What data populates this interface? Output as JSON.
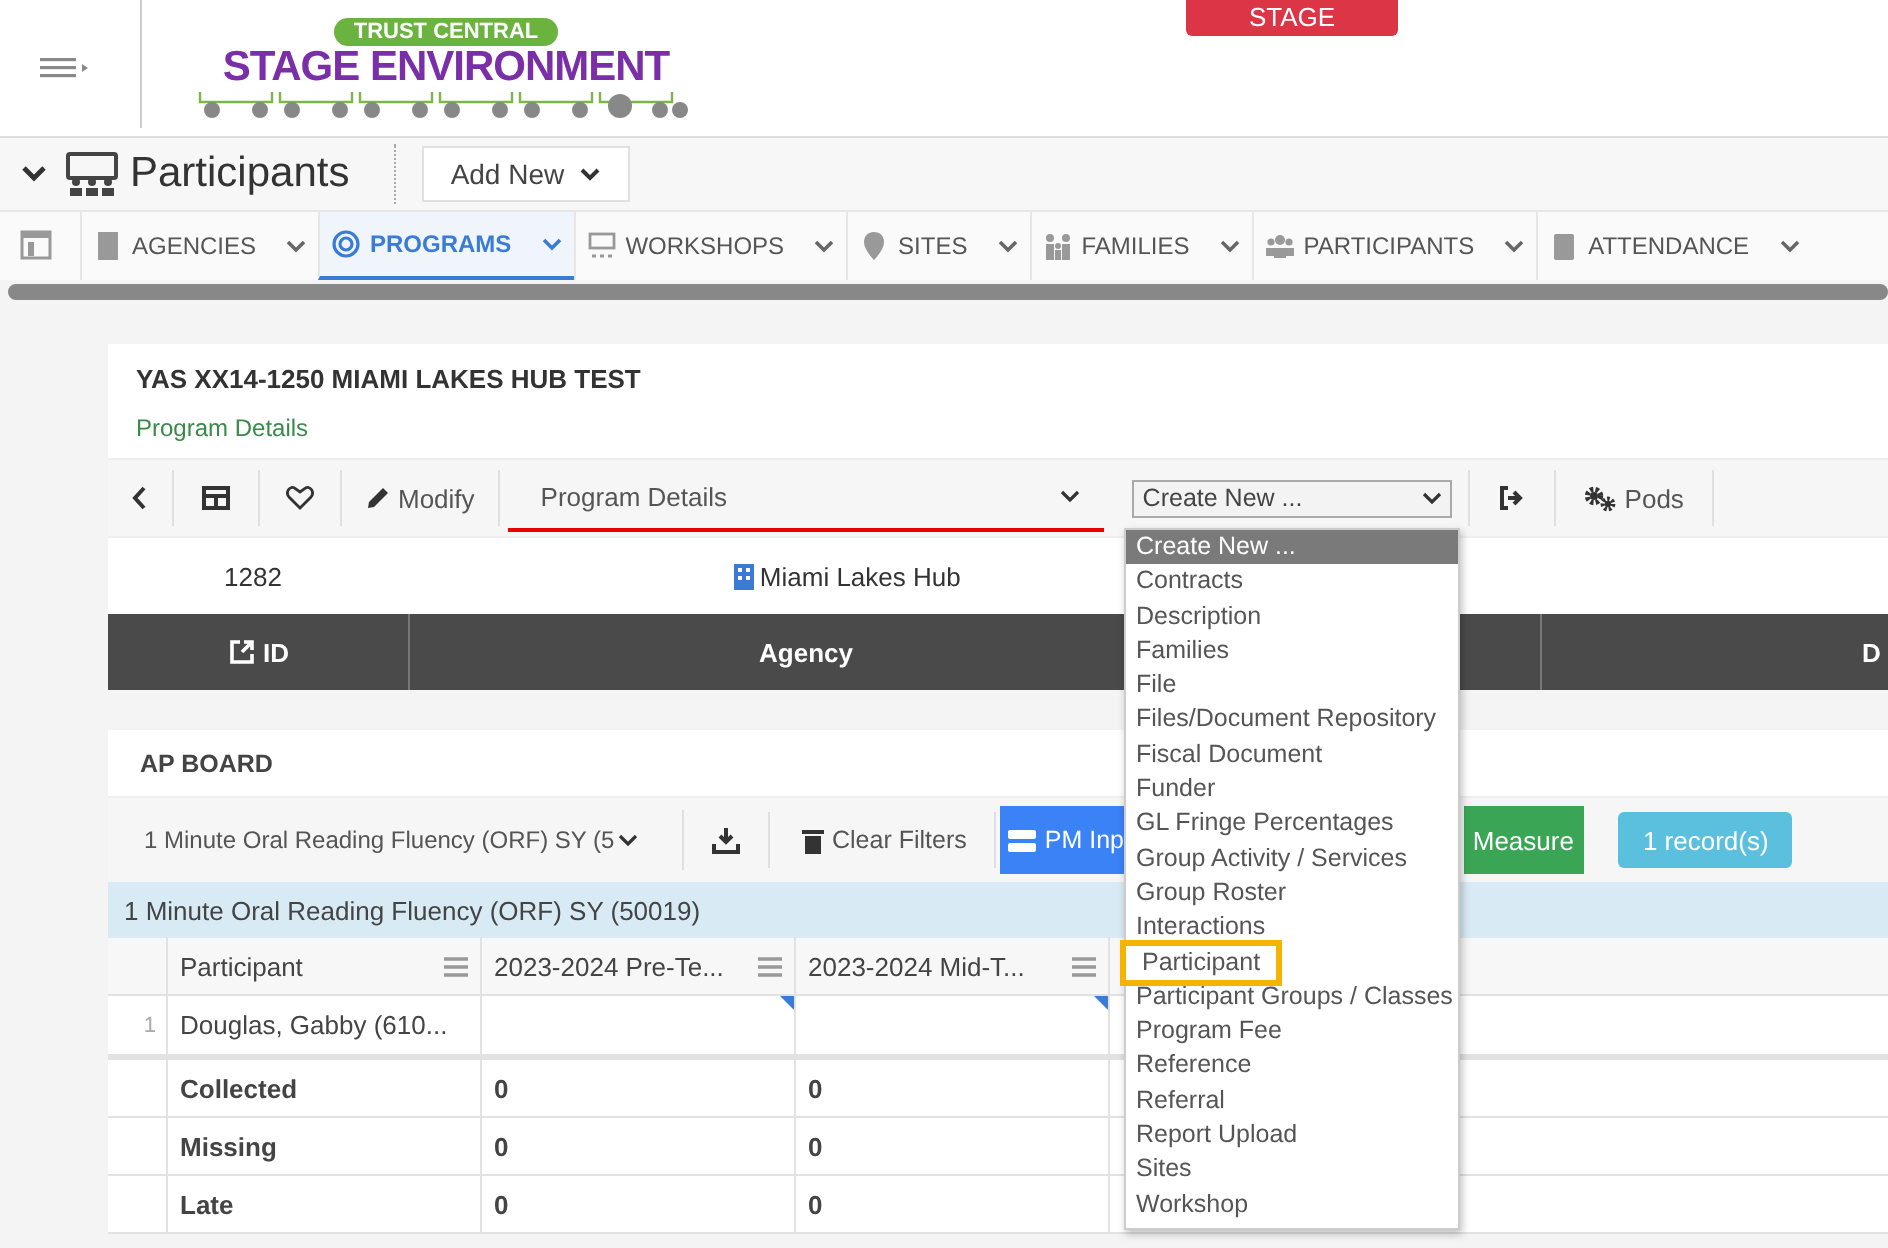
{
  "header": {
    "logo_top": "TRUST CENTRAL",
    "logo_main": "STAGE ENVIRONMENT",
    "stage_badge": "STAGE"
  },
  "page": {
    "title": "Participants",
    "add_button": "Add New"
  },
  "nav_tabs": [
    {
      "label": "AGENCIES",
      "selected": false
    },
    {
      "label": "PROGRAMS",
      "selected": true
    },
    {
      "label": "WORKSHOPS",
      "selected": false
    },
    {
      "label": "SITES",
      "selected": false
    },
    {
      "label": "FAMILIES",
      "selected": false
    },
    {
      "label": "PARTICIPANTS",
      "selected": false
    },
    {
      "label": "ATTENDANCE",
      "selected": false
    }
  ],
  "program": {
    "title": "YAS XX14-1250 MIAMI LAKES HUB TEST",
    "subtitle": "Program Details"
  },
  "toolbar": {
    "modify": "Modify",
    "view_select": "Program Details",
    "create_select": "Create New ...",
    "pods": "Pods"
  },
  "detail_row": {
    "id": "1282",
    "agency": "Miami Lakes Hub"
  },
  "detail_columns": [
    "ID",
    "Agency",
    "D"
  ],
  "board": {
    "title": "AP BOARD",
    "measure_select": "1 Minute Oral Reading Fluency (ORF) SY (5",
    "clear_filters": "Clear Filters",
    "buttons": [
      {
        "label": "PM Inp",
        "kind": "primary"
      },
      {
        "label": "Measure",
        "kind": "success"
      },
      {
        "label": "1 record(s)",
        "kind": "info"
      }
    ],
    "group": "1 Minute Oral Reading Fluency (ORF) SY (50019)",
    "columns": [
      "Participant",
      "2023-2024 Pre-Te...",
      "2023-2024 Mid-T..."
    ],
    "rows": [
      {
        "number": "1",
        "participant": "Douglas, Gabby (610..."
      }
    ],
    "summary": [
      {
        "label": "Collected",
        "values": [
          "0",
          "0"
        ]
      },
      {
        "label": "Missing",
        "values": [
          "0",
          "0"
        ]
      },
      {
        "label": "Late",
        "values": [
          "0",
          "0"
        ]
      }
    ]
  },
  "create_menu": [
    {
      "label": "Create New ...",
      "selected": true,
      "highlighted": false
    },
    {
      "label": "Contracts",
      "selected": false,
      "highlighted": false
    },
    {
      "label": "Description",
      "selected": false,
      "highlighted": false
    },
    {
      "label": "Families",
      "selected": false,
      "highlighted": false
    },
    {
      "label": "File",
      "selected": false,
      "highlighted": false
    },
    {
      "label": "Files/Document Repository",
      "selected": false,
      "highlighted": false
    },
    {
      "label": "Fiscal Document",
      "selected": false,
      "highlighted": false
    },
    {
      "label": "Funder",
      "selected": false,
      "highlighted": false
    },
    {
      "label": "GL Fringe Percentages",
      "selected": false,
      "highlighted": false
    },
    {
      "label": "Group Activity / Services",
      "selected": false,
      "highlighted": false
    },
    {
      "label": "Group Roster",
      "selected": false,
      "highlighted": false
    },
    {
      "label": "Interactions",
      "selected": false,
      "highlighted": false
    },
    {
      "label": "Participant",
      "selected": false,
      "highlighted": true
    },
    {
      "label": "Participant Groups / Classes",
      "selected": false,
      "highlighted": false
    },
    {
      "label": "Program Fee",
      "selected": false,
      "highlighted": false
    },
    {
      "label": "Reference",
      "selected": false,
      "highlighted": false
    },
    {
      "label": "Referral",
      "selected": false,
      "highlighted": false
    },
    {
      "label": "Report Upload",
      "selected": false,
      "highlighted": false
    },
    {
      "label": "Sites",
      "selected": false,
      "highlighted": false
    },
    {
      "label": "Workshop",
      "selected": false,
      "highlighted": false
    }
  ]
}
